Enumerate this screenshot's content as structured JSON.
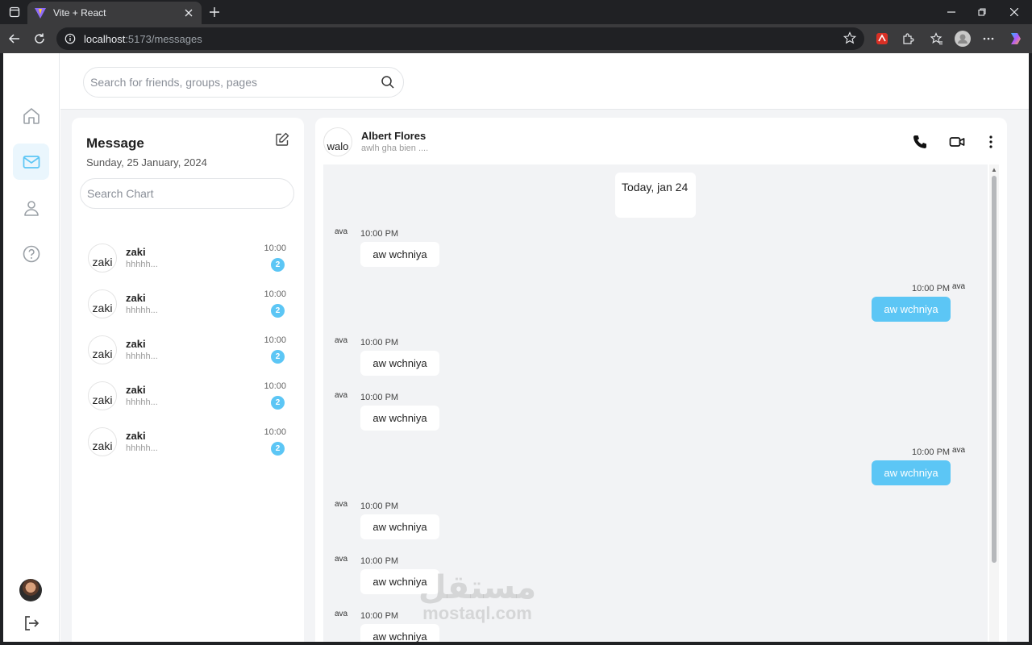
{
  "browser": {
    "tab_title": "Vite + React",
    "url_host": "localhost",
    "url_path": ":5173/messages"
  },
  "app": {
    "search_placeholder": "Search for friends, groups, pages",
    "accent": "#5cc6f5",
    "rail": [
      "home-icon",
      "mail-icon",
      "user-icon",
      "help-icon",
      "logout-icon"
    ]
  },
  "messages_panel": {
    "title": "Message",
    "date": "Sunday, 25 January, 2024",
    "search_placeholder": "Search Chart",
    "conversations": [
      {
        "avatar_alt": "zaki",
        "name": "zaki",
        "preview": "hhhhh...",
        "time": "10:00",
        "unread": "2"
      },
      {
        "avatar_alt": "zaki",
        "name": "zaki",
        "preview": "hhhhh...",
        "time": "10:00",
        "unread": "2"
      },
      {
        "avatar_alt": "zaki",
        "name": "zaki",
        "preview": "hhhhh...",
        "time": "10:00",
        "unread": "2"
      },
      {
        "avatar_alt": "zaki",
        "name": "zaki",
        "preview": "hhhhh...",
        "time": "10:00",
        "unread": "2"
      },
      {
        "avatar_alt": "zaki",
        "name": "zaki",
        "preview": "hhhhh...",
        "time": "10:00",
        "unread": "2"
      }
    ]
  },
  "chat": {
    "contact_avatar_alt": "walo",
    "contact_name": "Albert Flores",
    "contact_status": "awlh gha bien ....",
    "day_label": "Today, jan 24",
    "messages": [
      {
        "dir": "in",
        "time": "10:00 PM",
        "text": "aw wchniya",
        "avatar_alt": "ava"
      },
      {
        "dir": "out",
        "time": "10:00 PM",
        "text": "aw wchniya",
        "avatar_alt": "ava"
      },
      {
        "dir": "in",
        "time": "10:00 PM",
        "text": "aw wchniya",
        "avatar_alt": "ava"
      },
      {
        "dir": "in",
        "time": "10:00 PM",
        "text": "aw wchniya",
        "avatar_alt": "ava"
      },
      {
        "dir": "out",
        "time": "10:00 PM",
        "text": "aw wchniya",
        "avatar_alt": "ava"
      },
      {
        "dir": "in",
        "time": "10:00 PM",
        "text": "aw wchniya",
        "avatar_alt": "ava"
      },
      {
        "dir": "in",
        "time": "10:00 PM",
        "text": "aw wchniya",
        "avatar_alt": "ava"
      },
      {
        "dir": "in",
        "time": "10:00 PM",
        "text": "aw wchniya",
        "avatar_alt": "ava"
      }
    ]
  },
  "watermark": {
    "arabic": "مستقل",
    "latin": "mostaql.com"
  }
}
